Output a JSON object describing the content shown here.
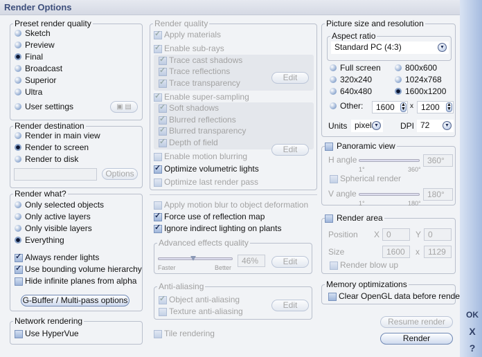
{
  "title": "Render Options",
  "preset": {
    "label": "Preset render quality",
    "items": [
      {
        "label": "Sketch",
        "checked": false
      },
      {
        "label": "Preview",
        "checked": false
      },
      {
        "label": "Final",
        "checked": true
      },
      {
        "label": "Broadcast",
        "checked": false
      },
      {
        "label": "Superior",
        "checked": false
      },
      {
        "label": "Ultra",
        "checked": false
      },
      {
        "label": "User settings",
        "checked": false
      }
    ],
    "icons": [
      "open-preset-icon",
      "save-preset-icon"
    ]
  },
  "destination": {
    "label": "Render destination",
    "items": [
      {
        "label": "Render in main view",
        "checked": false
      },
      {
        "label": "Render to screen",
        "checked": true
      },
      {
        "label": "Render to disk",
        "checked": false
      }
    ],
    "path_value": "",
    "options_label": "Options"
  },
  "what": {
    "label": "Render what?",
    "items": [
      {
        "label": "Only selected objects",
        "checked": false
      },
      {
        "label": "Only active layers",
        "checked": false
      },
      {
        "label": "Only visible layers",
        "checked": false
      },
      {
        "label": "Everything",
        "checked": true
      }
    ],
    "checks": [
      {
        "label": "Always render lights",
        "checked": true
      },
      {
        "label": "Use bounding volume hierarchy",
        "checked": true
      },
      {
        "label": "Hide infinite planes from alpha",
        "checked": false
      }
    ],
    "gbuffer_label": "G-Buffer / Multi-pass options"
  },
  "network": {
    "label": "Network rendering",
    "hypervue": {
      "label": "Use HyperVue",
      "checked": false
    }
  },
  "quality": {
    "label": "Render quality",
    "apply_materials": "Apply materials",
    "enable_subrays": "Enable sub-rays",
    "trace_cast_shadows": "Trace cast shadows",
    "trace_reflections": "Trace reflections",
    "trace_transparency": "Trace transparency",
    "edit": "Edit",
    "enable_supersampling": "Enable super-sampling",
    "soft_shadows": "Soft shadows",
    "blurred_reflections": "Blurred reflections",
    "blurred_transparency": "Blurred transparency",
    "depth_of_field": "Depth of field",
    "enable_motion_blurring": "Enable motion blurring",
    "optimize_volumetric": "Optimize volumetric lights",
    "optimize_last_pass": "Optimize last render pass"
  },
  "misc": {
    "apply_motion_blur_deform": "Apply motion blur to object deformation",
    "force_reflection_map": "Force use of reflection map",
    "ignore_indirect_plants": "Ignore indirect lighting on plants"
  },
  "advanced": {
    "label": "Advanced effects quality",
    "faster": "Faster",
    "better": "Better",
    "value": "46%",
    "edit": "Edit"
  },
  "antialias": {
    "label": "Anti-aliasing",
    "object": "Object anti-aliasing",
    "texture": "Texture anti-aliasing",
    "edit": "Edit"
  },
  "tile": "Tile rendering",
  "picture": {
    "label": "Picture size and resolution",
    "aspect_label": "Aspect ratio",
    "aspect_value": "Standard PC (4:3)",
    "sizes": [
      {
        "label": "Full screen",
        "checked": false
      },
      {
        "label": "320x240",
        "checked": false
      },
      {
        "label": "640x480",
        "checked": false
      },
      {
        "label": "800x600",
        "checked": false
      },
      {
        "label": "1024x768",
        "checked": false
      },
      {
        "label": "1600x1200",
        "checked": true
      }
    ],
    "other_label": "Other:",
    "width": "1600",
    "times": "x",
    "height": "1200",
    "units_label": "Units",
    "units_value": "pixels",
    "dpi_label": "DPI",
    "dpi_value": "72"
  },
  "panoramic": {
    "label": "Panoramic view",
    "h_angle": "H angle",
    "h_value": "360°",
    "h_min": "1°",
    "h_max": "360°",
    "spherical": "Spherical render",
    "v_angle": "V angle",
    "v_value": "180°",
    "v_min": "1°",
    "v_max": "180°"
  },
  "area": {
    "label": "Render area",
    "position": "Position",
    "x": "X",
    "x_value": "0",
    "y": "Y",
    "y_value": "0",
    "size": "Size",
    "w_value": "1600",
    "times": "x",
    "h_value": "1129",
    "blowup": "Render blow up"
  },
  "memory": {
    "label": "Memory optimizations",
    "clear_opengl": "Clear OpenGL data before render"
  },
  "buttons": {
    "resume": "Resume render",
    "render": "Render",
    "ok": "OK",
    "close": "X",
    "help": "?"
  }
}
